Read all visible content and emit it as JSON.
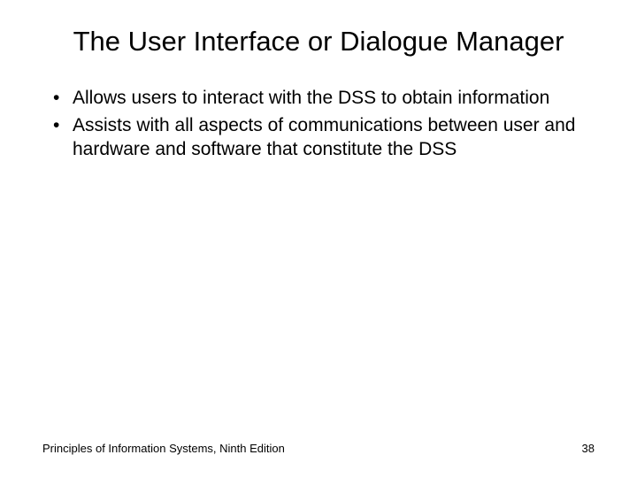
{
  "slide": {
    "title": "The User Interface or Dialogue Manager",
    "bullets": [
      "Allows users to interact with the DSS to obtain information",
      "Assists with all aspects of communications between user and hardware and software that constitute the DSS"
    ],
    "footer": {
      "source": "Principles of Information Systems, Ninth Edition",
      "page": "38"
    }
  }
}
